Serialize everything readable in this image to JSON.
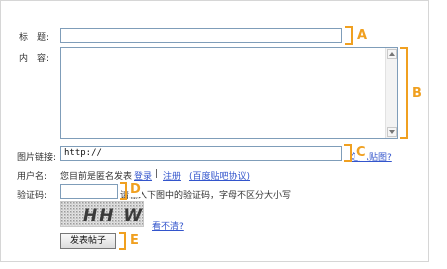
{
  "form": {
    "title_label": "标　题:",
    "content_label": "内　容:",
    "image_link_label": "图片链接:",
    "image_link_value": "http://",
    "image_help_link": "怎么贴图?",
    "username_label": "用户名:",
    "anonymous_notice": "您目前是匿名发表",
    "login_link": "登录",
    "separator": "|",
    "register_link": "注册",
    "agreement_link": "(百度贴吧协议)",
    "captcha_label": "验证码:",
    "captcha_instruction": "请输入下图中的验证码，字母不区分大小写",
    "captcha_text": "HH WX",
    "captcha_refresh_link": "看不清?",
    "submit_label": "发表帖子"
  },
  "annotations": [
    "A",
    "B",
    "C",
    "D",
    "E"
  ],
  "colors": {
    "accent": "#f0a020",
    "link": "#3355cc",
    "field_border": "#7f9db9"
  }
}
